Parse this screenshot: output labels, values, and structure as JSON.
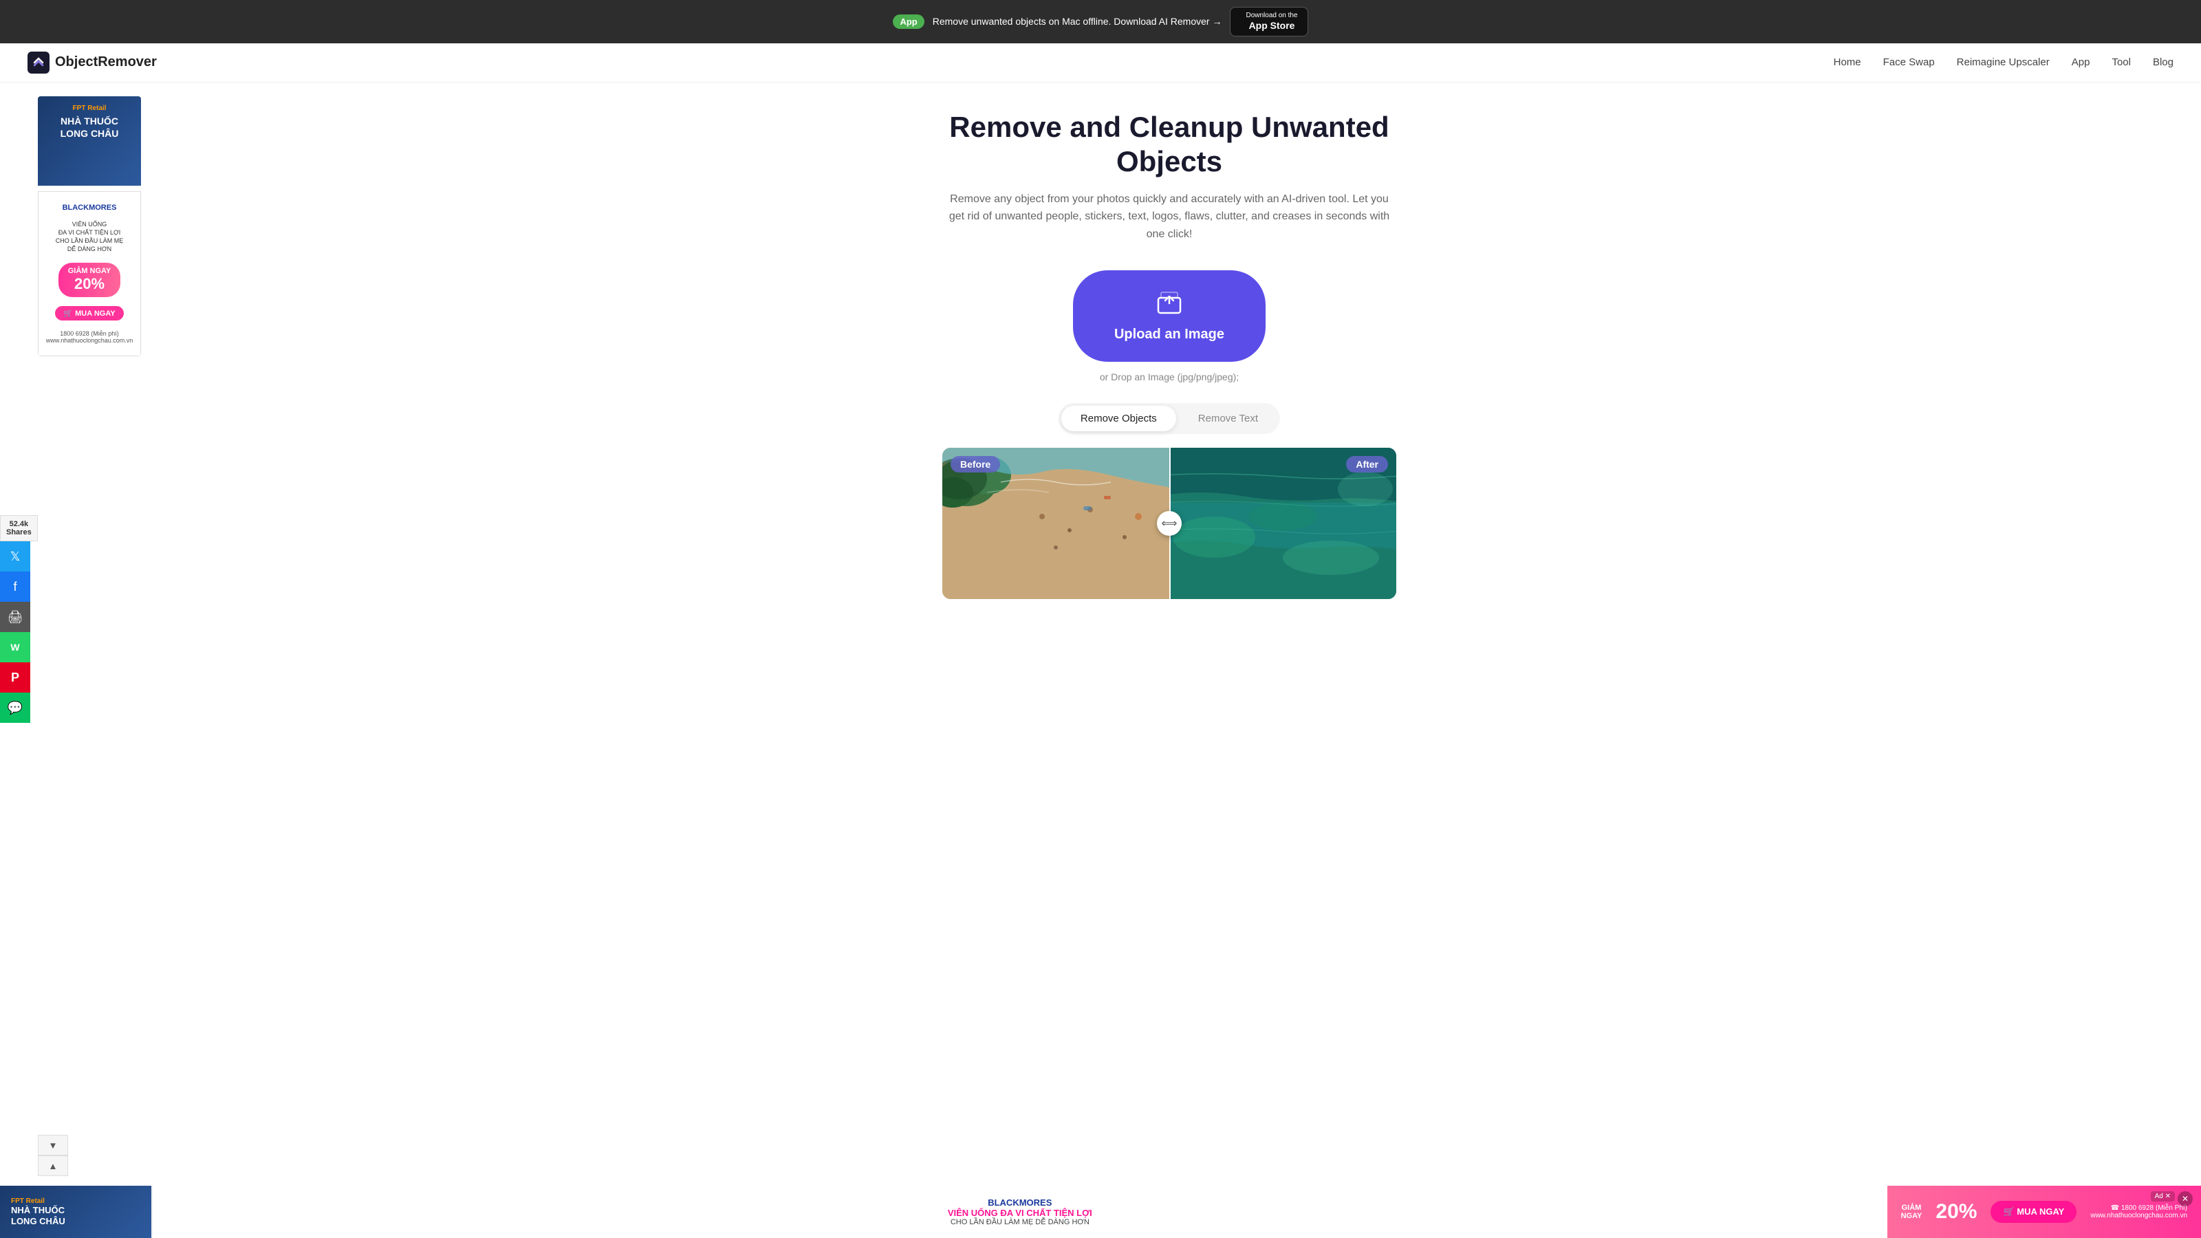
{
  "banner": {
    "app_label": "App",
    "text": "Remove unwanted objects on Mac offline. Download AI Remover →",
    "store_line1": "Download on the",
    "store_line2": "App Store"
  },
  "nav": {
    "logo": "ObjectRemover",
    "links": [
      "Home",
      "Face Swap",
      "Reimagine Upscaler",
      "App",
      "Tool",
      "Blog"
    ]
  },
  "social": {
    "count": "52.4k",
    "label": "Shares"
  },
  "hero": {
    "title": "Remove and Cleanup Unwanted Objects",
    "subtitle": "Remove any object from your photos quickly and accurately with an AI-driven tool. Let you get rid of unwanted people, stickers, text, logos, flaws, clutter, and creases in seconds with one click!",
    "upload_label": "Upload an Image",
    "drop_hint": "or Drop an Image (jpg/png/jpeg);"
  },
  "tabs": {
    "tab1": "Remove Objects",
    "tab2": "Remove Text"
  },
  "preview": {
    "before_label": "Before",
    "after_label": "After"
  },
  "bottom_ad": {
    "logo_name": "FPT Retail",
    "logo_sub": "NHÀ THUỐC LONG CHÂU",
    "brand": "BLACKMORES",
    "headline": "VIÊN UỐNG ĐA VI CHẤT TIỆN LỢI",
    "sub": "CHO LẦN ĐẦU LÀM MẸ DỄ DÀNG HƠN",
    "discount": "GIẢM NGAY 20%",
    "cta": "MUA NGAY",
    "phone": "☎ 1800 6928 (Miễn Phí)",
    "website": "www.nhathuoclongchau.com.vn",
    "close": "✕"
  },
  "icons": {
    "twitter": "𝕏",
    "facebook": "f",
    "print": "🖨",
    "whatsapp": "W",
    "pinterest": "P",
    "wechat": "💬",
    "upload": "⬆",
    "arrow_left": "‹",
    "arrow_right": "›",
    "chevron_down": "▼",
    "chevron_up": "▲",
    "apple": ""
  }
}
